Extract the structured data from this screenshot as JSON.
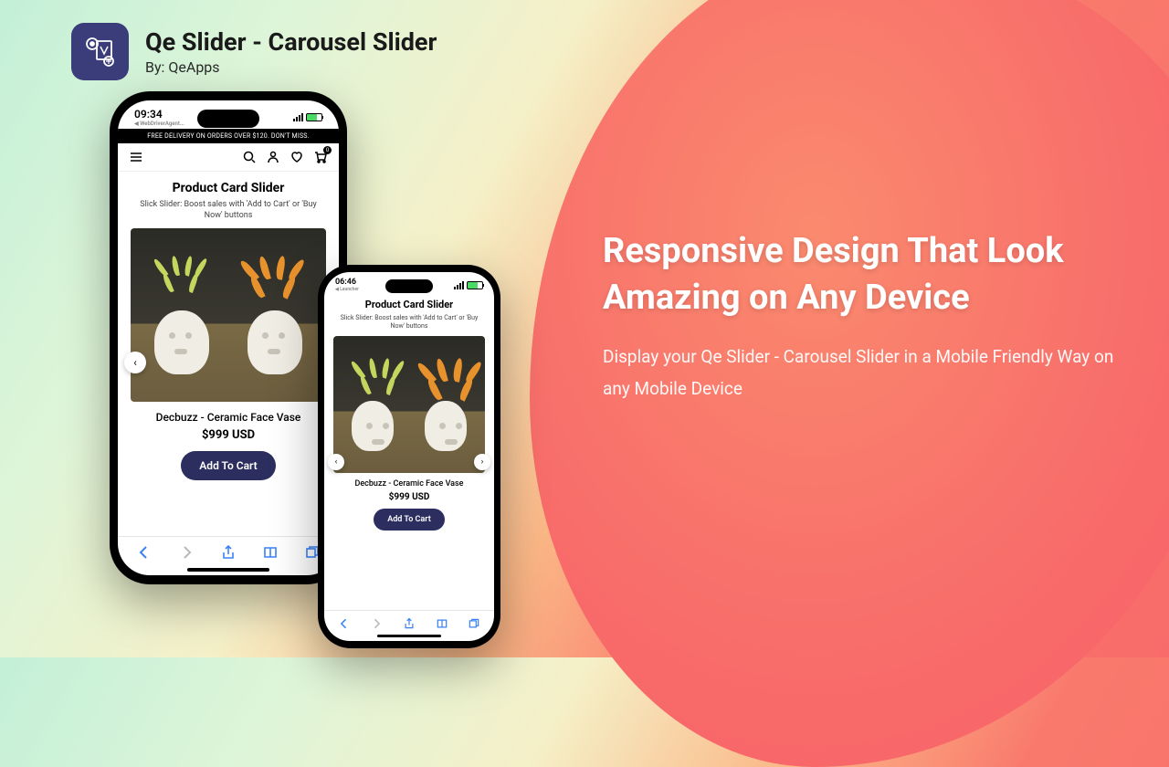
{
  "header": {
    "title": "Qe Slider - Carousel Slider",
    "by": "By: QeApps"
  },
  "hero": {
    "h1": "Responsive Design That Look Amazing on Any Device",
    "p": "Display your Qe Slider - Carousel Slider in a Mobile Friendly Way on any Mobile Device"
  },
  "phone_large": {
    "time": "09:34",
    "source": "◀ WebDriverAgent...",
    "banner": "FREE DELIVERY ON ORDERS OVER $120. DON'T MISS."
  },
  "phone_small": {
    "time": "06:46",
    "source": "◀ Launcher"
  },
  "card": {
    "title": "Product Card Slider",
    "subtitle": "Slick Slider: Boost sales with 'Add to Cart' or 'Buy Now' buttons"
  },
  "product": {
    "name": "Decbuzz - Ceramic Face Vase",
    "price": "$999 USD",
    "cta": "Add To Cart"
  },
  "icons": {
    "menu": "☰",
    "search": "⌕",
    "user": "◯",
    "heart": "♡",
    "cart": "🛒",
    "prev": "‹",
    "next": "›",
    "back": "‹",
    "fwd": "›",
    "share": "⇪",
    "book": "▭",
    "tabs": "⧉"
  }
}
